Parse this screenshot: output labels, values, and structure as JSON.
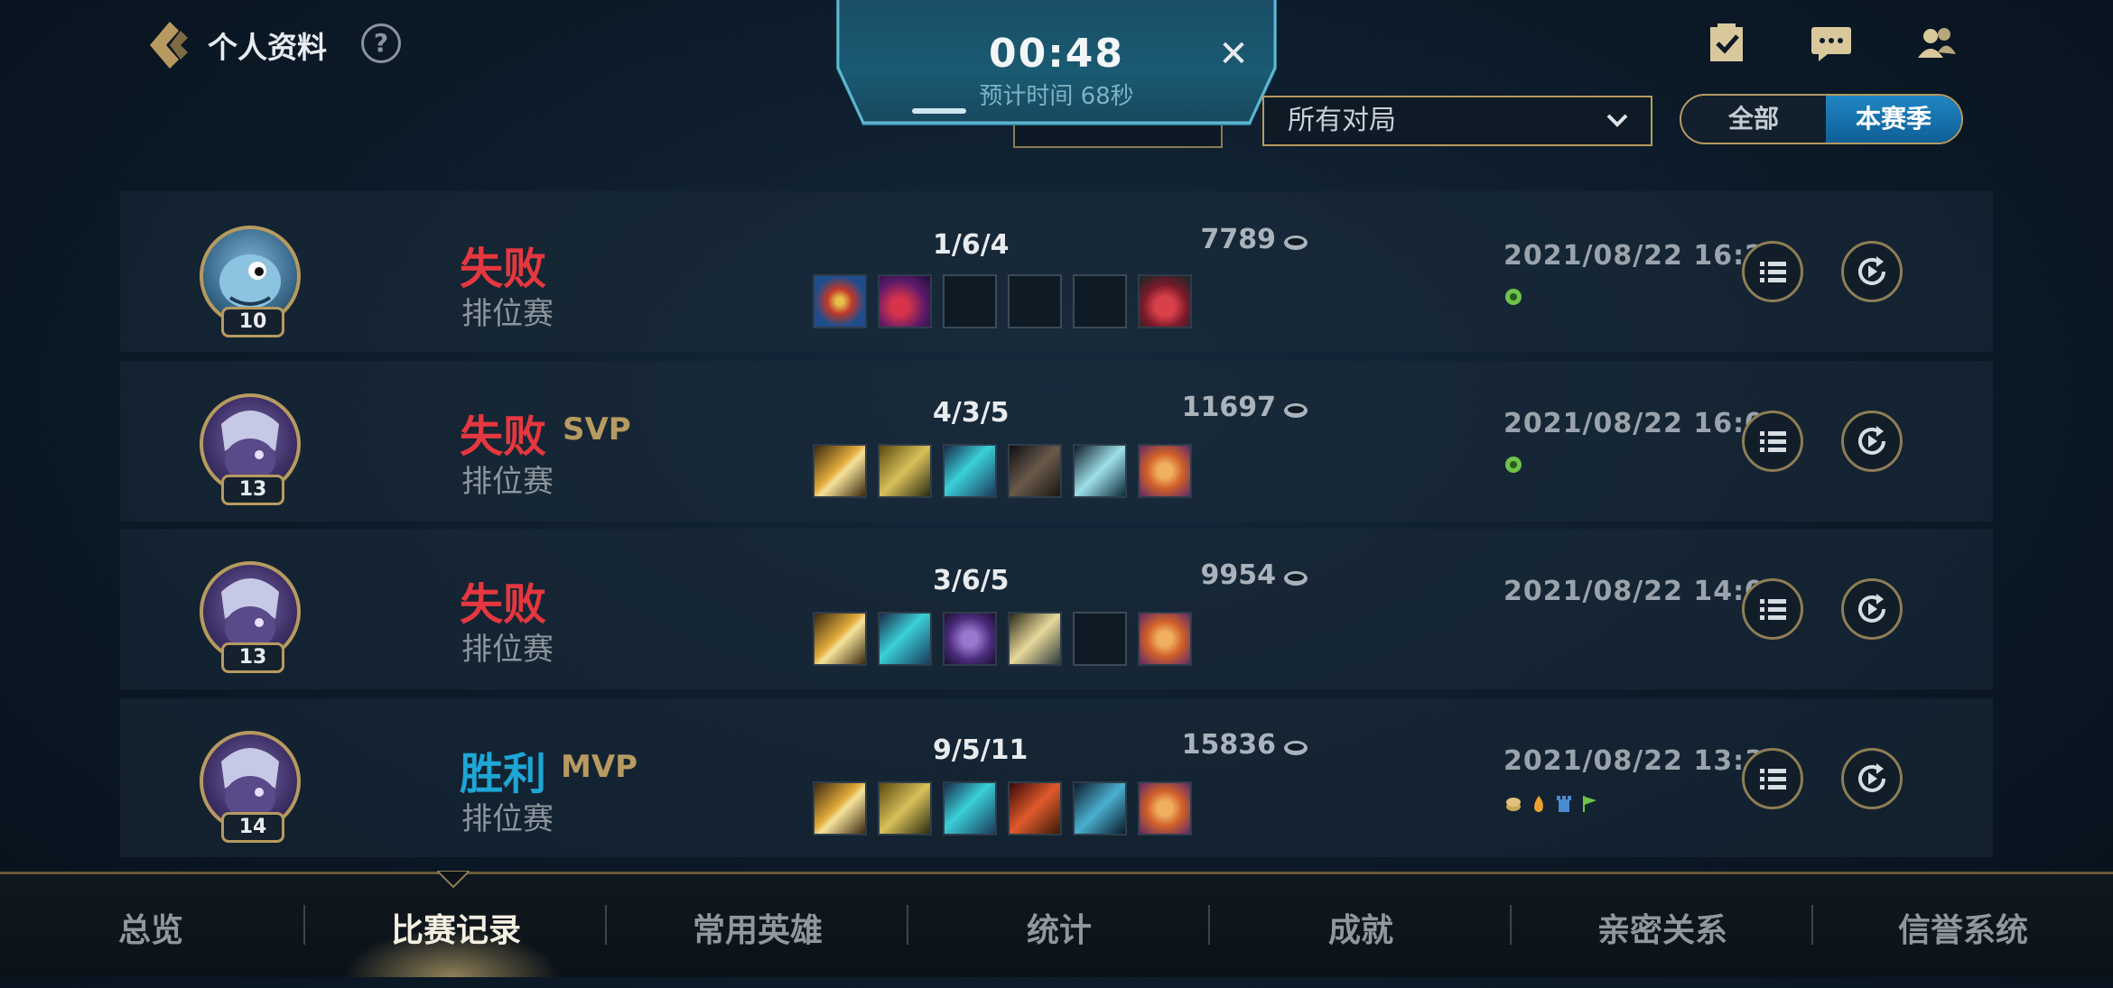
{
  "header": {
    "title": "个人资料",
    "help_label": "?",
    "timer": {
      "value": "00:48",
      "estimate": "预计时间 68秒",
      "close": "✕"
    },
    "filter": {
      "selected": "所有对局"
    },
    "season_toggle": {
      "all": "全部",
      "season": "本赛季",
      "selected": "本赛季"
    },
    "icons": [
      "task-checklist-icon",
      "chat-bubble-icon",
      "friends-icon"
    ]
  },
  "matches": [
    {
      "result": "失败",
      "result_type": "loss",
      "badge": "",
      "mode": "排位赛",
      "level": "10",
      "kda": "1/6/4",
      "gold": "7789",
      "date": "2021/08/22 16:21",
      "items": [
        "item",
        "item",
        "empty",
        "empty",
        "empty",
        "item"
      ],
      "extra_icons": [
        "green-coin-icon"
      ]
    },
    {
      "result": "失败",
      "result_type": "loss",
      "badge": "SVP",
      "mode": "排位赛",
      "level": "13",
      "kda": "4/3/5",
      "gold": "11697",
      "date": "2021/08/22 16:00",
      "items": [
        "item",
        "item",
        "item",
        "item",
        "item",
        "item"
      ],
      "extra_icons": [
        "green-coin-icon"
      ]
    },
    {
      "result": "失败",
      "result_type": "loss",
      "badge": "",
      "mode": "排位赛",
      "level": "13",
      "kda": "3/6/5",
      "gold": "9954",
      "date": "2021/08/22 14:00",
      "items": [
        "item",
        "item",
        "item",
        "item",
        "empty",
        "item"
      ],
      "extra_icons": []
    },
    {
      "result": "胜利",
      "result_type": "win",
      "badge": "MVP",
      "mode": "排位赛",
      "level": "14",
      "kda": "9/5/11",
      "gold": "15836",
      "date": "2021/08/22 13:39",
      "items": [
        "item",
        "item",
        "item",
        "item",
        "item",
        "item"
      ],
      "extra_icons": [
        "coin-icon",
        "fire-icon",
        "tower-icon",
        "flag-icon"
      ]
    }
  ],
  "tabs": [
    {
      "label": "总览"
    },
    {
      "label": "比赛记录"
    },
    {
      "label": "常用英雄"
    },
    {
      "label": "统计"
    },
    {
      "label": "成就"
    },
    {
      "label": "亲密关系"
    },
    {
      "label": "信誉系统"
    }
  ],
  "active_tab": "比赛记录",
  "colors": {
    "loss": "#e5373f",
    "win": "#1ea6d6",
    "gold_border": "#b69a60",
    "active_toggle": "#1f86c3"
  }
}
